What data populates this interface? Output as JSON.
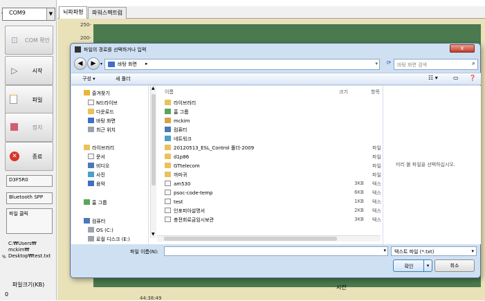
{
  "left_panel": {
    "port_select": "COM9",
    "percent_mark": "%",
    "buttons": [
      {
        "label": "COM 확인",
        "icon": "plug-icon",
        "disabled": true
      },
      {
        "label": "시작",
        "icon": "play-icon",
        "disabled": false
      },
      {
        "label": "파일",
        "icon": "file-icon",
        "disabled": false
      },
      {
        "label": "정지",
        "icon": "stop-icon",
        "disabled": true
      },
      {
        "label": "종료",
        "icon": "close-icon",
        "disabled": false
      }
    ],
    "device_id": "D3F5R0",
    "connection_type": "Bluetooth SPP",
    "file_click_label": "파일 클릭",
    "path_prefix": "%",
    "path_text": "C:₩Users₩ mckim₩ Desktop₩test.txt",
    "file_size_label": "파일크기(KB)",
    "file_size_value": "0"
  },
  "tabs": [
    {
      "label": "뇌파파형",
      "active": true
    },
    {
      "label": "파워스펙트럼",
      "active": false
    }
  ],
  "chart": {
    "y_ticks": [
      "250-",
      "200-"
    ],
    "x_label": "시간",
    "x_tick_partial": "44:38:49"
  },
  "dialog": {
    "title": "파일의 경로를 선택하거나 입력",
    "close_glyph": "x",
    "address_location": "바탕 화면",
    "address_arrow": "▸",
    "search_placeholder": "바탕 화면 검색",
    "toolbar": {
      "organize": "구성 ▾",
      "new_folder": "새 폴더"
    },
    "tree": {
      "favorites_header": "즐겨찾기",
      "favorites": [
        "N드라이브",
        "다운로드",
        "바탕 화면",
        "최근 위치"
      ],
      "libraries_header": "라이브러리",
      "libraries": [
        "문서",
        "비디오",
        "사진",
        "음악"
      ],
      "homegroup": "홈 그룹",
      "computer_header": "컴퓨터",
      "drives": [
        "OS (C:)",
        "로컬 디스크 (E:)"
      ]
    },
    "columns": {
      "name": "이름",
      "size": "크기",
      "type": "항목"
    },
    "files": [
      {
        "name": "라이브러리",
        "size": "",
        "type": "",
        "icon": "folder"
      },
      {
        "name": "홈 그룹",
        "size": "",
        "type": "",
        "icon": "green"
      },
      {
        "name": "mckim",
        "size": "",
        "type": "",
        "icon": "person"
      },
      {
        "name": "컴퓨터",
        "size": "",
        "type": "",
        "icon": "pc"
      },
      {
        "name": "네트워크",
        "size": "",
        "type": "",
        "icon": "net"
      },
      {
        "name": "20120513_ESL_Control 폴더-2009",
        "size": "",
        "type": "파일",
        "icon": "folder"
      },
      {
        "name": "d1p86",
        "size": "",
        "type": "파일",
        "icon": "folder"
      },
      {
        "name": "GTtelecom",
        "size": "",
        "type": "파일",
        "icon": "folder"
      },
      {
        "name": "까마귀",
        "size": "",
        "type": "파일",
        "icon": "folder"
      },
      {
        "name": "am530",
        "size": "3KB",
        "type": "텍스",
        "icon": "doc"
      },
      {
        "name": "psoc-code-temp",
        "size": "6KB",
        "type": "텍스",
        "icon": "doc"
      },
      {
        "name": "test",
        "size": "1KB",
        "type": "텍스",
        "icon": "doc"
      },
      {
        "name": "인포피아설명서",
        "size": "2KB",
        "type": "텍스",
        "icon": "doc"
      },
      {
        "name": "충전회로금임시보관",
        "size": "3KB",
        "type": "텍스",
        "icon": "doc"
      }
    ],
    "preview_text": "미리 볼 파일을 선택하십시오.",
    "filename_label": "파일 이름(N):",
    "filename_value": "",
    "filetype_value": "텍스트 파일 (*.txt)",
    "ok_label": "확인",
    "cancel_label": "취소"
  }
}
